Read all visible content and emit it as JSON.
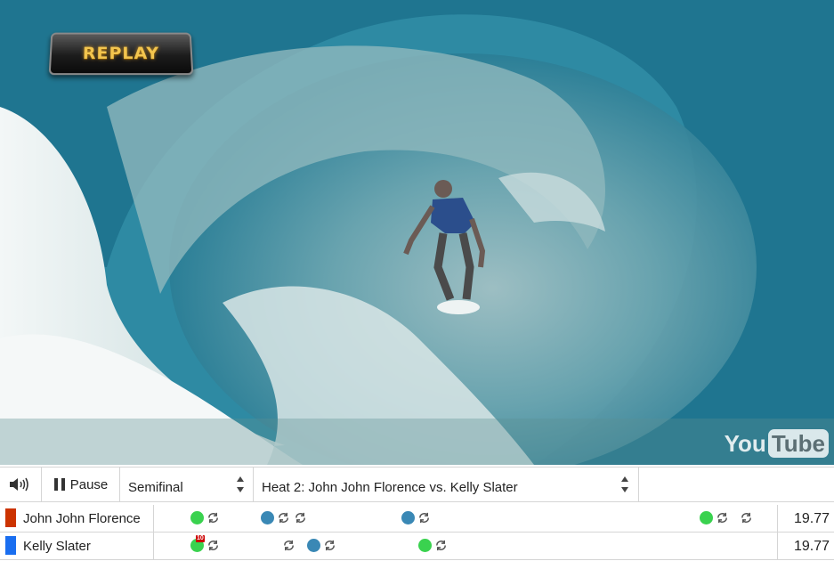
{
  "video": {
    "overlay_label": "REPLAY",
    "watermark": {
      "left": "You",
      "right": "Tube"
    }
  },
  "controls": {
    "volume_icon": "speaker-icon",
    "pause_label": "Pause",
    "round_select": {
      "value": "Semifinal"
    },
    "heat_select": {
      "value": "Heat 2: John John Florence vs. Kelly Slater"
    }
  },
  "surfers": [
    {
      "name": "John John Florence",
      "color": "#cc3300",
      "total": "19.77"
    },
    {
      "name": "Kelly Slater",
      "color": "#1a6ef0",
      "total": "19.77",
      "badge": "10"
    }
  ],
  "colors": {
    "wave_green": "#3ad24f",
    "wave_blue": "#3a88b5"
  }
}
